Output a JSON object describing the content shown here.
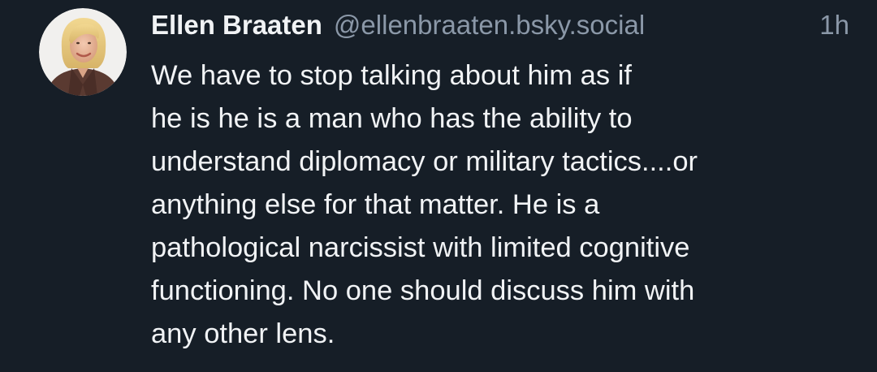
{
  "post": {
    "author": {
      "display_name": "Ellen Braaten",
      "handle": "@ellenbraaten.bsky.social",
      "avatar_icon": "profile-photo"
    },
    "timestamp": "1h",
    "text_lines": [
      "We have to stop talking about him as if",
      "he is he is a man who has the ability to",
      "understand diplomacy or military tactics....or",
      "anything else for that matter. He is a",
      "pathological narcissist with limited cognitive",
      "functioning. No one should discuss him with",
      "any other lens."
    ]
  },
  "colors": {
    "background": "#161e27",
    "primary_text": "#f1f3f5",
    "secondary_text": "#8b98a8"
  }
}
